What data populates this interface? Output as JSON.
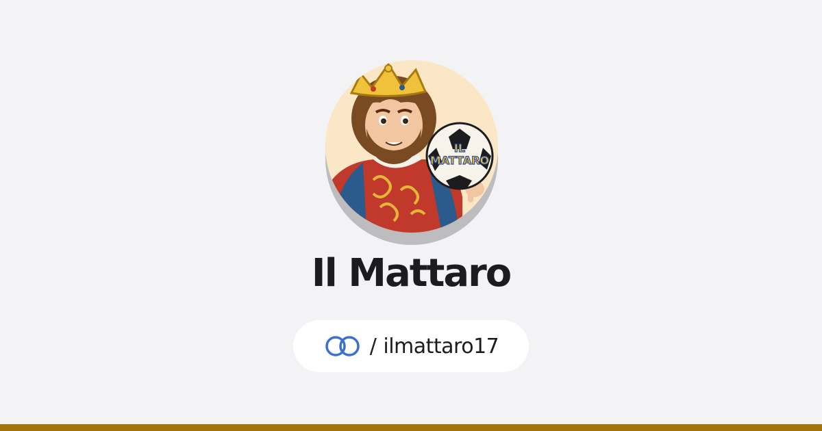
{
  "profile": {
    "display_name": "Il Mattaro",
    "separator": "/",
    "handle": "ilmattaro17",
    "handle_icon": "linked-rings-icon",
    "avatar_badge_line1": "IL",
    "avatar_badge_line2": "MATTARO"
  },
  "colors": {
    "background": "#f3f3f5",
    "accent_bar": "#a2740c",
    "handle_icon": "#3b6fd6",
    "text": "#1c1c1e"
  }
}
